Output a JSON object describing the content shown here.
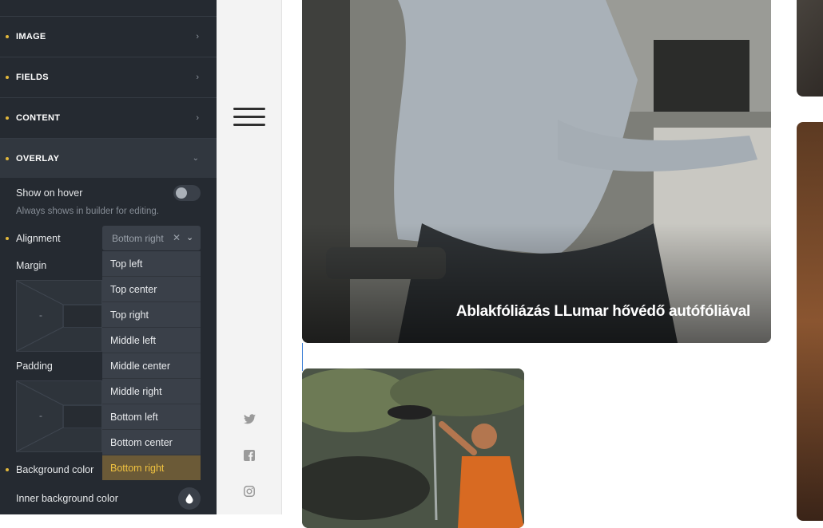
{
  "panel": {
    "sections": [
      {
        "label": "IMAGE",
        "chevron": "chevron-right-icon"
      },
      {
        "label": "FIELDS",
        "chevron": "chevron-right-icon"
      },
      {
        "label": "CONTENT",
        "chevron": "chevron-right-icon"
      },
      {
        "label": "OVERLAY",
        "chevron": "chevron-down-icon"
      }
    ],
    "show_on_hover": {
      "label": "Show on hover",
      "hint": "Always shows in builder for editing.",
      "enabled": false
    },
    "alignment": {
      "label": "Alignment",
      "selected": "Bottom right",
      "options": [
        "Top left",
        "Top center",
        "Top right",
        "Middle left",
        "Middle center",
        "Middle right",
        "Bottom left",
        "Bottom center",
        "Bottom right"
      ]
    },
    "margin": {
      "label": "Margin",
      "value": "-"
    },
    "padding": {
      "label": "Padding",
      "value": "-"
    },
    "background_color": {
      "label": "Background color"
    },
    "inner_background_color": {
      "label": "Inner background color",
      "icon": "droplet-icon"
    },
    "accent_color": "#e3b83b"
  },
  "nav": {
    "menu_icon": "hamburger-menu-icon",
    "social": [
      "twitter-icon",
      "facebook-icon",
      "instagram-icon"
    ]
  },
  "content": {
    "card_title": "Ablakfóliázás LLumar hővédő autófóliával"
  }
}
